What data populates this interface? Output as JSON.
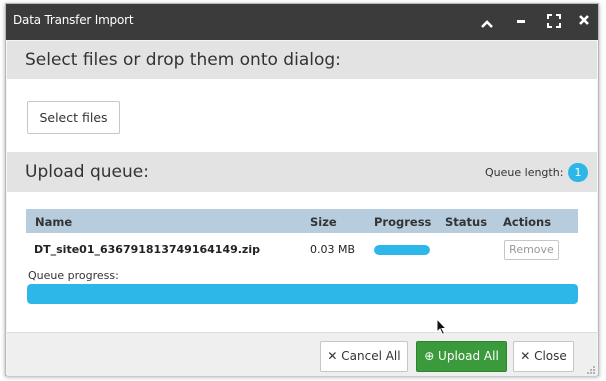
{
  "window": {
    "title": "Data Transfer Import",
    "controls": {
      "up": "⌃",
      "minimize": "–",
      "maximize": "⛶",
      "close": "✕"
    }
  },
  "select_section": {
    "heading": "Select files or drop them onto dialog:",
    "select_button": "Select files"
  },
  "queue_section": {
    "heading": "Upload queue:",
    "queue_length_label": "Queue length:",
    "queue_length": "1"
  },
  "table": {
    "headers": [
      "Name",
      "Size",
      "Progress",
      "Status",
      "Actions"
    ],
    "rows": [
      {
        "name": "DT_site01_636791813749164149.zip",
        "size": "0.03 MB",
        "progress": 1.0,
        "status": "",
        "action": "Remove"
      }
    ]
  },
  "queue_progress": {
    "label": "Queue progress:",
    "value": 1.0
  },
  "footer": {
    "cancel_all": "✕ Cancel All",
    "upload_all": "⊕ Upload All",
    "close": "✕ Close"
  },
  "colors": {
    "titlebar": "#3b3b3b",
    "accent": "#2db6e8",
    "upload_button": "#3b9a3b",
    "table_header": "#b7cdde"
  }
}
